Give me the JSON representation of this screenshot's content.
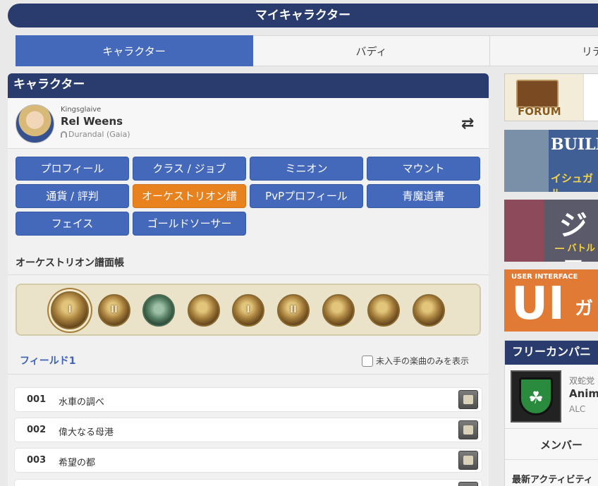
{
  "header": {
    "title": "マイキャラクター"
  },
  "tabs": [
    {
      "label": "キャラクター",
      "active": true
    },
    {
      "label": "バディ",
      "active": false
    },
    {
      "label": "リテ",
      "active": false
    }
  ],
  "panel": {
    "title": "キャラクター"
  },
  "character": {
    "job": "Kingsglaive",
    "name": "Rel Weens",
    "world": "Durandal (Gaia)",
    "swap_icon": "swap-arrows-icon"
  },
  "menu": [
    {
      "label": "プロフィール",
      "active": false
    },
    {
      "label": "クラス / ジョブ",
      "active": false
    },
    {
      "label": "ミニオン",
      "active": false
    },
    {
      "label": "マウント",
      "active": false
    },
    {
      "label": "通貨 / 評判",
      "active": false
    },
    {
      "label": "オーケストリオン譜",
      "active": true
    },
    {
      "label": "PvPプロフィール",
      "active": false
    },
    {
      "label": "青魔道書",
      "active": false
    },
    {
      "label": "フェイス",
      "active": false
    },
    {
      "label": "ゴールドソーサー",
      "active": false
    }
  ],
  "orchestrion": {
    "section_title": "オーケストリオン譜面帳",
    "categories": [
      {
        "icon": "crystal-i-icon",
        "mark": "I",
        "selected": true
      },
      {
        "icon": "crystal-ii-icon",
        "mark": "II",
        "selected": false
      },
      {
        "icon": "cave-icon",
        "mark": "",
        "selected": false
      },
      {
        "icon": "wings-icon",
        "mark": "",
        "selected": false
      },
      {
        "icon": "arch-i-icon",
        "mark": "I",
        "selected": false
      },
      {
        "icon": "arch-ii-icon",
        "mark": "II",
        "selected": false
      },
      {
        "icon": "bird-icon",
        "mark": "",
        "selected": false
      },
      {
        "icon": "bag-icon",
        "mark": "",
        "selected": false
      },
      {
        "icon": "drop-icon",
        "mark": "",
        "selected": false
      }
    ],
    "field_title": "フィールド1",
    "filter_label": "未入手の楽曲のみを表示",
    "songs": [
      {
        "num": "001",
        "name": "水車の調べ"
      },
      {
        "num": "002",
        "name": "偉大なる母港"
      },
      {
        "num": "003",
        "name": "希望の都"
      }
    ]
  },
  "sidebar": {
    "forum_label": "FORUM",
    "builder_title": "BUILDE",
    "builder_sub": "イシュガル",
    "job_title": "ジョ",
    "job_sub": "― バトル",
    "ui_small": "USER INTERFACE",
    "ui_big": "UI",
    "ui_sub": "ガ",
    "fc_title": "フリーカンパニ",
    "fc_gc": "双蛇党",
    "fc_name": "Anim",
    "fc_tag": "ALC",
    "fc_member": "メンバー",
    "fc_activity": "最新アクティビティ"
  }
}
